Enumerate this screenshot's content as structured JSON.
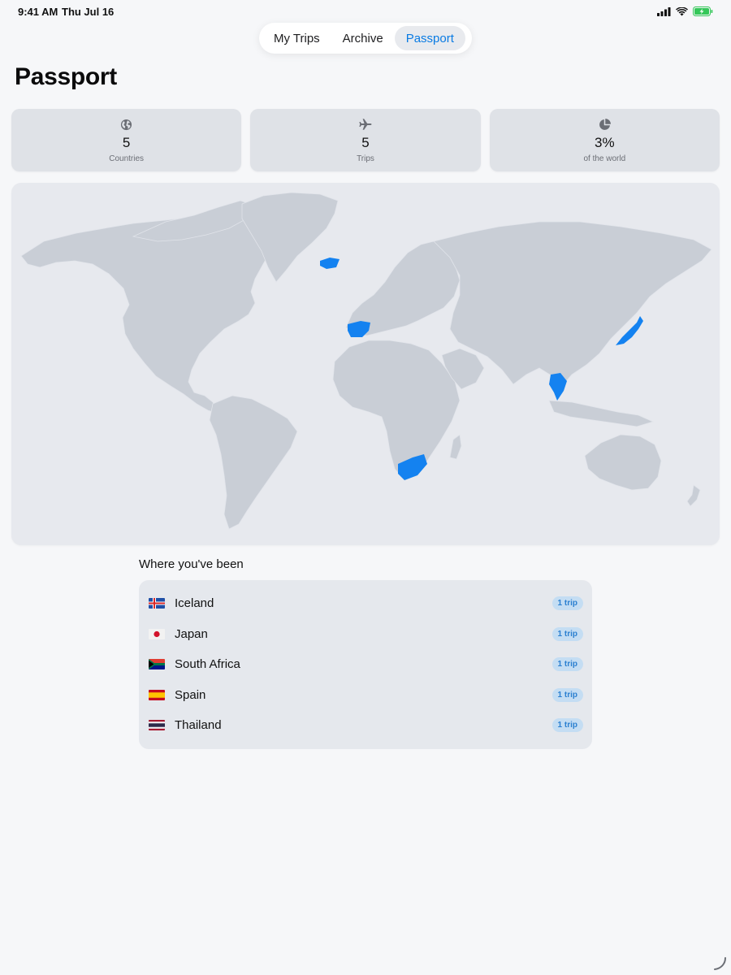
{
  "status_bar": {
    "time": "9:41 AM",
    "date": "Thu Jul 16"
  },
  "tabs": [
    {
      "label": "My Trips",
      "active": false
    },
    {
      "label": "Archive",
      "active": false
    },
    {
      "label": "Passport",
      "active": true
    }
  ],
  "page_title": "Passport",
  "stats": [
    {
      "icon": "globe-icon",
      "value": "5",
      "label": "Countries"
    },
    {
      "icon": "airplane-icon",
      "value": "5",
      "label": "Trips"
    },
    {
      "icon": "pie-chart-icon",
      "value": "3%",
      "label": "of the world"
    }
  ],
  "map": {
    "visited_color": "#1482f0",
    "land_color": "#c9ced6",
    "background_color": "#e7e9ee",
    "visited": [
      "Iceland",
      "Japan",
      "South Africa",
      "Spain",
      "Thailand"
    ]
  },
  "section_title": "Where you've been",
  "countries": [
    {
      "name": "Iceland",
      "trips": "1 trip",
      "flag": "iceland-flag-icon"
    },
    {
      "name": "Japan",
      "trips": "1 trip",
      "flag": "japan-flag-icon"
    },
    {
      "name": "South Africa",
      "trips": "1 trip",
      "flag": "south-africa-flag-icon"
    },
    {
      "name": "Spain",
      "trips": "1 trip",
      "flag": "spain-flag-icon"
    },
    {
      "name": "Thailand",
      "trips": "1 trip",
      "flag": "thailand-flag-icon"
    }
  ],
  "colors": {
    "accent": "#0a7be3",
    "badge_bg": "#c4ddf3",
    "badge_text": "#2a7fd0"
  }
}
